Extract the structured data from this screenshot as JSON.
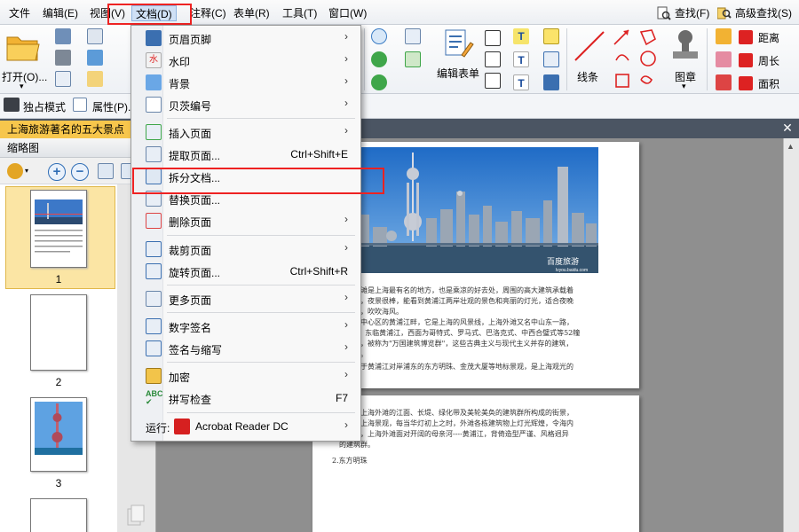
{
  "menubar": {
    "items": [
      "文件",
      "编辑(E)",
      "视图(V)",
      "文档(D)",
      "注释(C)",
      "表单(R)",
      "工具(T)",
      "窗口(W)"
    ],
    "search_label": "查找(F)",
    "advanced_search_label": "高级查找(S)"
  },
  "ribbon": {
    "open_label": "打开(O)...",
    "edit_form_label": "编辑表单",
    "line_label": "线条",
    "stamp_label": "图章",
    "distance_label": "距离",
    "perimeter_label": "周长",
    "area_label": "面积"
  },
  "toolbar2": {
    "exclusive_mode_label": "独占模式",
    "properties_label": "属性(P)..."
  },
  "tab": {
    "title": "上海旅游著名的五大景点"
  },
  "thumbnails": {
    "panel_title": "缩略图",
    "pages": [
      "1",
      "2",
      "3"
    ]
  },
  "menu": {
    "items": [
      {
        "label": "页眉页脚",
        "shortcut": "",
        "submenu": true,
        "icon": "header-footer-icon"
      },
      {
        "label": "水印",
        "shortcut": "",
        "submenu": true,
        "icon": "watermark-icon"
      },
      {
        "label": "背景",
        "shortcut": "",
        "submenu": true,
        "icon": "background-icon"
      },
      {
        "label": "贝茨编号",
        "shortcut": "",
        "submenu": true,
        "icon": "bates-number-icon"
      },
      {
        "label": "插入页面",
        "shortcut": "",
        "submenu": true,
        "icon": "insert-page-icon"
      },
      {
        "label": "提取页面...",
        "shortcut": "Ctrl+Shift+E",
        "submenu": false,
        "icon": "extract-page-icon"
      },
      {
        "label": "拆分文档...",
        "shortcut": "",
        "submenu": false,
        "icon": "split-document-icon"
      },
      {
        "label": "替换页面...",
        "shortcut": "",
        "submenu": false,
        "icon": "replace-page-icon"
      },
      {
        "label": "删除页面",
        "shortcut": "",
        "submenu": true,
        "icon": "delete-page-icon"
      },
      {
        "label": "裁剪页面",
        "shortcut": "",
        "submenu": true,
        "icon": "crop-page-icon"
      },
      {
        "label": "旋转页面...",
        "shortcut": "Ctrl+Shift+R",
        "submenu": false,
        "icon": "rotate-page-icon"
      },
      {
        "label": "更多页面",
        "shortcut": "",
        "submenu": true,
        "icon": "more-pages-icon"
      },
      {
        "label": "数字签名",
        "shortcut": "",
        "submenu": true,
        "icon": "digital-signature-icon"
      },
      {
        "label": "签名与缩写",
        "shortcut": "",
        "submenu": true,
        "icon": "sign-initial-icon"
      },
      {
        "label": "加密",
        "shortcut": "",
        "submenu": true,
        "icon": "encrypt-icon"
      },
      {
        "label": "拼写检查",
        "shortcut": "F7",
        "submenu": false,
        "icon": "spell-check-icon"
      }
    ],
    "run_prefix": "运行:",
    "run_app": "Acrobat Reader DC"
  },
  "page1": {
    "photo_watermark": "百度旅游",
    "photo_watermark_url": "lvyou.baidu.com",
    "lines": [
      "象，外滩是上海最有名的地方，也是乘凉的好去处，周围的高大建筑承载着",
      "的沉淀，夜景很棒，能看到黄浦江两岸壮观的景色和亮丽的灯光，适合夜晚",
      "看夜色，吹吹海风。",
      "上海市中心区的黄浦江畔，它是上海的风景线，上海外滩又名中山东一路，",
      "5公里，东临黄浦江，西面为哥特式、罗马式、巴洛克式、中西合璧式等52幢",
      "的大楼，被称为\"万国建筑博览群\"，这些古典主义与现代主义并存的建筑，",
      "的象征。",
      "还有位于黄浦江对岸浦东的东方明珠、金茂大厦等地标景观，是上海观光的"
    ]
  },
  "page2": {
    "lines": [
      "之地，上海外滩的江面、长堤、绿化带及美轮美奂的建筑群所构成的街景，",
      "特征的上海景观，每当华灯初上之时，外滩各栋建筑物上灯光辉煌，令海内",
      "叹不已，上海外滩面对开阔的母亲河----黄浦江，背倚造型严谨、风格迥异",
      "的建筑群。"
    ],
    "section_title": "2.东方明珠"
  },
  "colors": {
    "highlight_red": "#e22222",
    "tab_yellow": "#f7c64c",
    "selected_thumb": "#fbe5a4",
    "menu_bg": "#f8f8f8"
  }
}
